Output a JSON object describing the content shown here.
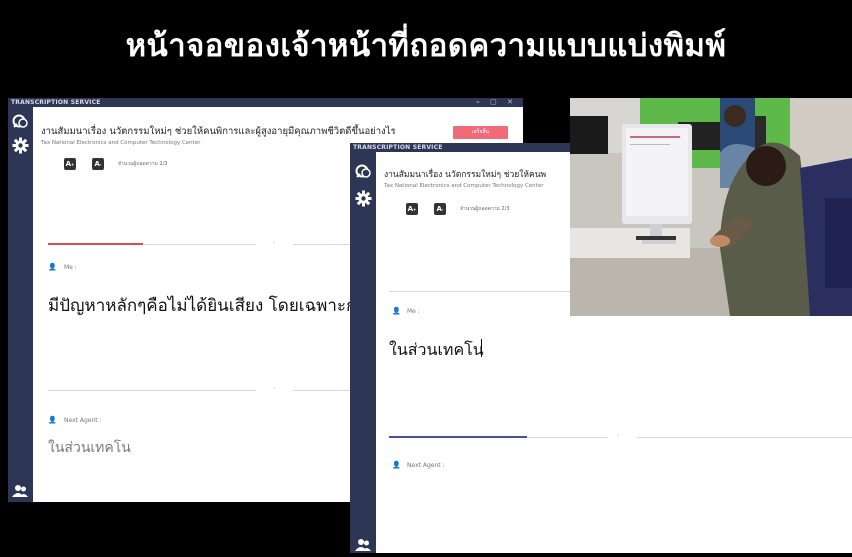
{
  "slide": {
    "title": "หน้าจอของเจ้าหน้าที่ถอดความแบบแบ่งพิมพ์"
  },
  "window_back": {
    "title_bar": "TRANSCRIPTION SERVICE",
    "window_controls": "– ▢ ✕",
    "topic": "งานสัมมนาเรื่อง นวัตกรรมใหม่ๆ ช่วยให้คนพิการและผู้สูงอายุมีคุณภาพชีวิตดีขึ้นอย่างไร",
    "org": "Tax National Electronics and Computer Technology Center",
    "font_up": "A",
    "font_down": "A",
    "count": "จำนวนผู้ถอดความ 2/3",
    "red_button": "เสร็จสิ้น",
    "me_label": "Me :",
    "me_text": "มีปัญหาหลักๆคือไม่ได้ยินเสียง โดยเฉพาะกลุ่ม",
    "next_label": "Next Agent :",
    "next_text": "ในส่วนเทคโน",
    "progress_top": 0.32
  },
  "window_front": {
    "title_bar": "TRANSCRIPTION SERVICE",
    "topic": "งานสัมมนาเรื่อง นวัตกรรมใหม่ๆ ช่วยให้คนพ",
    "org": "Tax National Electronics and Computer Technology Center",
    "font_up": "A",
    "font_down": "A",
    "count": "จำนวนผู้ถอดความ 2/3",
    "me_label": "Me :",
    "me_text": "ในส่วนเทคโน",
    "next_label": "Next Agent :",
    "progress_bottom": 0.3
  },
  "colors": {
    "sidebar": "#2e3656",
    "progress_red": "#e04a4a",
    "progress_blue": "#4a4f9a",
    "button_red": "#f06a7a"
  },
  "icons": [
    "chat-icon",
    "gear-icon",
    "users-icon"
  ]
}
